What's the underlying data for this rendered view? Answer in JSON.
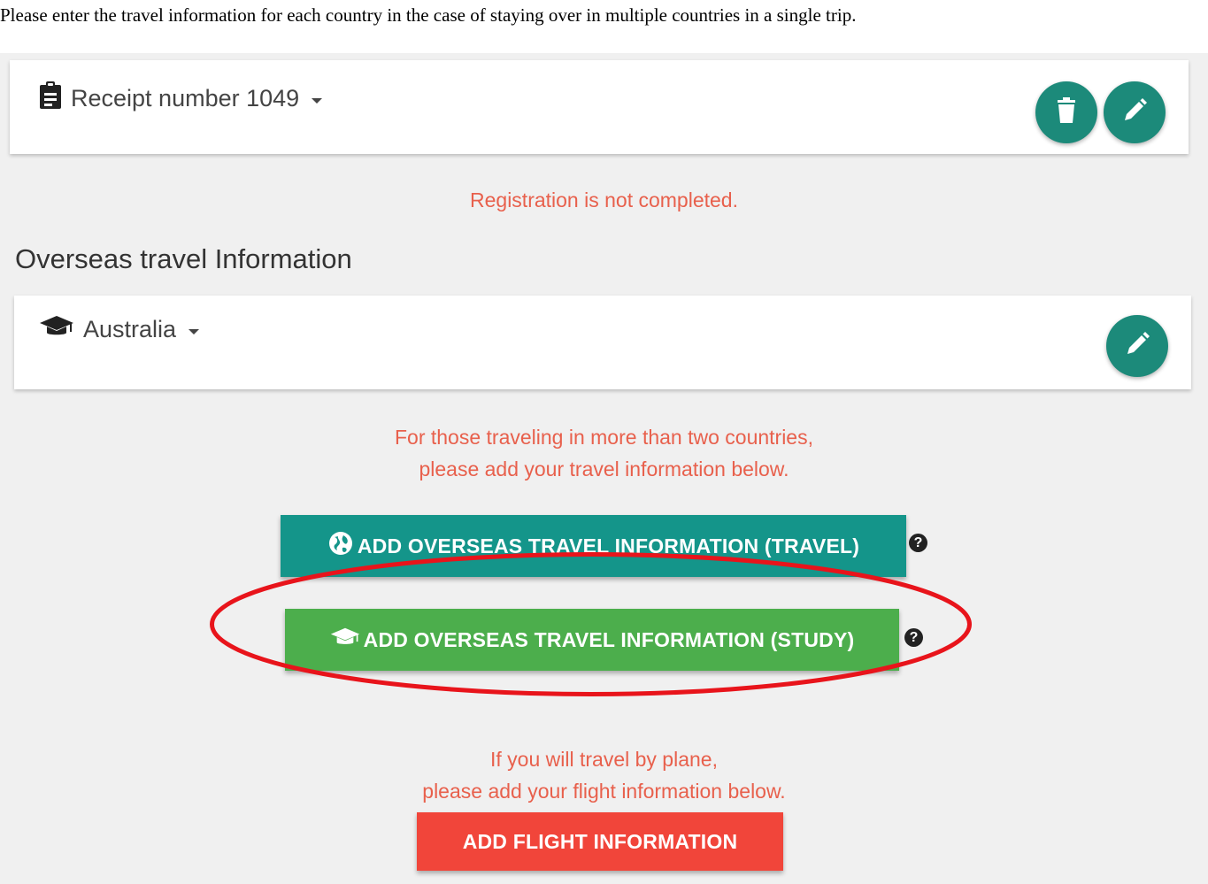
{
  "instruction_text": "Please enter the travel information for each country in the case of staying over in multiple countries in a single trip.",
  "receipt": {
    "icon": "clipboard-icon",
    "title": "Receipt number 1049",
    "delete_icon": "trash-icon",
    "edit_icon": "pencil-icon"
  },
  "registration_status": "Registration is not completed.",
  "overseas": {
    "section_title": "Overseas travel Information",
    "country": {
      "icon": "graduation-cap-icon",
      "name": "Australia",
      "edit_icon": "pencil-icon"
    }
  },
  "multi_country_notice": {
    "line1": "For those traveling in more than two countries,",
    "line2": "please add your travel information below."
  },
  "buttons": {
    "add_travel": {
      "label": "ADD OVERSEAS TRAVEL INFORMATION (TRAVEL)",
      "icon": "globe-icon"
    },
    "add_study": {
      "label": "ADD OVERSEAS TRAVEL INFORMATION (STUDY)",
      "icon": "graduation-cap-icon"
    },
    "add_flight": {
      "label": "ADD FLIGHT INFORMATION"
    }
  },
  "help_icon": "question-circle-icon",
  "flight_notice": {
    "line1": "If you will travel by plane,",
    "line2": "please add your flight information below."
  },
  "colors": {
    "teal": "#14958a",
    "fab": "#1c8a7a",
    "green": "#4cae4c",
    "red": "#f1453a",
    "notice": "#e8604c",
    "annotation": "#e8141b"
  }
}
